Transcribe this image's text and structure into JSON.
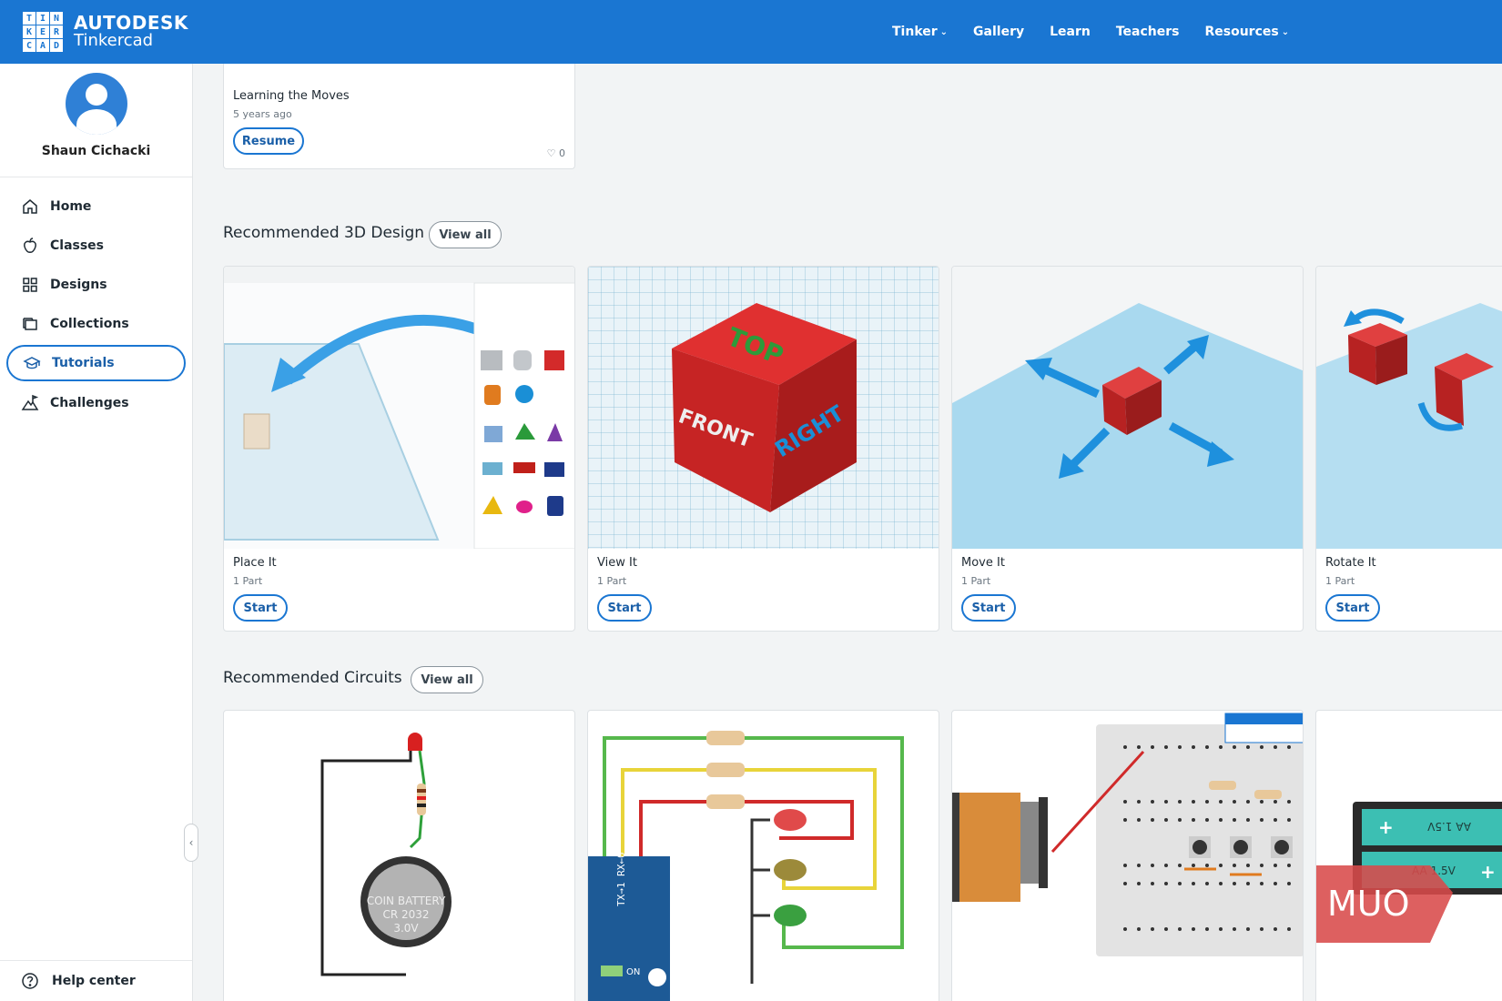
{
  "header": {
    "logo_letters": [
      "T",
      "I",
      "N",
      "K",
      "E",
      "R",
      "C",
      "A",
      "D"
    ],
    "brand": "AUTODESK",
    "product": "Tinkercad",
    "nav": [
      {
        "label": "Tinker",
        "dropdown": true
      },
      {
        "label": "Gallery",
        "dropdown": false
      },
      {
        "label": "Learn",
        "dropdown": false
      },
      {
        "label": "Teachers",
        "dropdown": false
      },
      {
        "label": "Resources",
        "dropdown": true
      }
    ]
  },
  "sidebar": {
    "user_name": "Shaun Cichacki",
    "items": [
      {
        "label": "Home",
        "icon": "home-icon",
        "active": false
      },
      {
        "label": "Classes",
        "icon": "apple-icon",
        "active": false
      },
      {
        "label": "Designs",
        "icon": "grid-icon",
        "active": false
      },
      {
        "label": "Collections",
        "icon": "folders-icon",
        "active": false
      },
      {
        "label": "Tutorials",
        "icon": "graduation-cap-icon",
        "active": true
      },
      {
        "label": "Challenges",
        "icon": "mountain-flag-icon",
        "active": false
      }
    ],
    "help": "Help center"
  },
  "resume_card": {
    "title": "Learning the Moves",
    "time": "5 years ago",
    "button": "Resume",
    "likes": "0"
  },
  "sections": {
    "design": {
      "title": "Recommended 3D Design",
      "view_all": "View all",
      "cards": [
        {
          "title": "Place It",
          "sub": "1 Part",
          "button": "Start"
        },
        {
          "title": "View It",
          "sub": "1 Part",
          "button": "Start"
        },
        {
          "title": "Move It",
          "sub": "1 Part",
          "button": "Start"
        },
        {
          "title": "Rotate It",
          "sub": "1 Part",
          "button": "Start"
        }
      ]
    },
    "circuits": {
      "title": "Recommended Circuits",
      "view_all": "View all"
    }
  },
  "thumb_text": {
    "cube_top": "TOP",
    "cube_front": "FRONT",
    "cube_right": "RIGHT",
    "battery": [
      "COIN BATTERY",
      "CR 2032",
      "3.0V"
    ],
    "arduino_pins": "TX→1  RX←0",
    "arduino_on": "ON",
    "aa_label": "AA 1.5V",
    "watermark": "MUO"
  },
  "colors": {
    "brand_blue": "#1a76d2",
    "cube_red": "#d32a2a",
    "arrow_blue": "#1e90dd"
  }
}
